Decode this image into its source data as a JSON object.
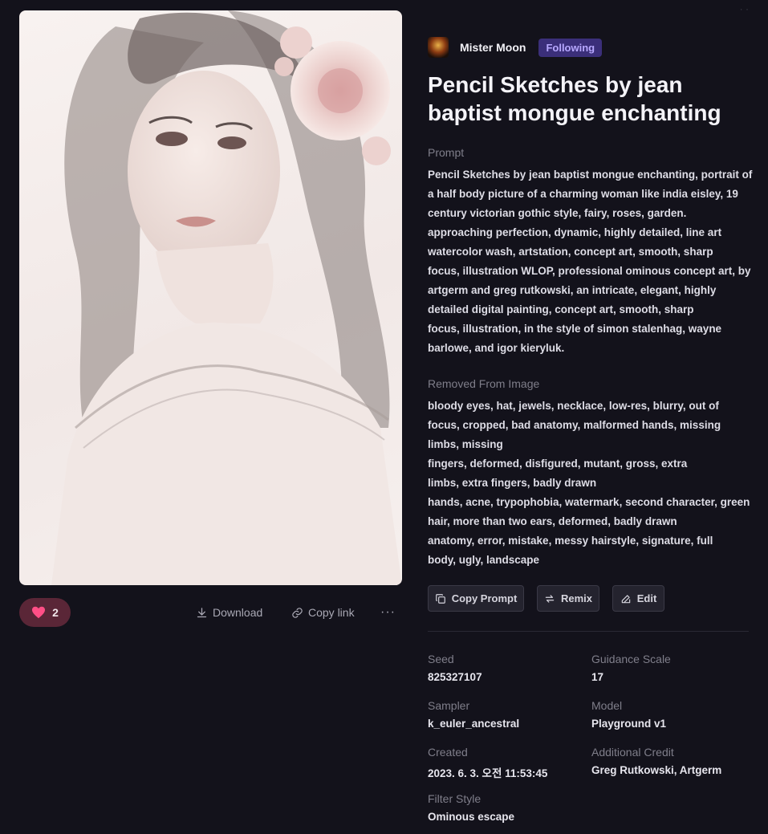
{
  "author": {
    "name": "Mister Moon",
    "follow_state": "Following"
  },
  "title": "Pencil Sketches by jean baptist mongue enchanting",
  "prompt": {
    "label": "Prompt",
    "lines": [
      "Pencil Sketches by jean baptist mongue enchanting, portrait of",
      "a half body picture of a charming woman like india eisley, 19",
      "century victorian gothic style, fairy, roses, garden.",
      "approaching perfection, dynamic, highly detailed, line art",
      "watercolor wash, artstation, concept art, smooth, sharp",
      "focus, illustration WLOP, professional ominous concept art, by",
      "artgerm and greg rutkowski, an intricate, elegant, highly",
      "detailed digital painting, concept art, smooth, sharp",
      "focus, illustration, in the style of simon stalenhag, wayne",
      "barlowe, and igor kieryluk."
    ]
  },
  "removed": {
    "label": "Removed From Image",
    "lines": [
      "bloody eyes, hat, jewels, necklace, low-res, blurry, out of",
      "focus, cropped, bad anatomy, malformed hands, missing",
      "limbs, missing",
      "fingers, deformed, disfigured, mutant, gross, extra",
      "limbs, extra fingers, badly drawn",
      "hands, acne, trypophobia, watermark, second character, green",
      "hair, more than two ears, deformed, badly drawn",
      "anatomy, error, mistake, messy hairstyle, signature, full",
      "body, ugly, landscape"
    ]
  },
  "buttons": {
    "copy_prompt": "Copy Prompt",
    "remix": "Remix",
    "edit": "Edit"
  },
  "actions": {
    "likes": "2",
    "download": "Download",
    "copy_link": "Copy link",
    "more": "···"
  },
  "meta": {
    "seed": {
      "label": "Seed",
      "value": "825327107"
    },
    "guidance": {
      "label": "Guidance Scale",
      "value": "17"
    },
    "sampler": {
      "label": "Sampler",
      "value": "k_euler_ancestral"
    },
    "model": {
      "label": "Model",
      "value": "Playground v1"
    },
    "created": {
      "label": "Created",
      "value": "2023. 6. 3. 오전 11:53:45"
    },
    "credit": {
      "label": "Additional Credit",
      "value": "Greg Rutkowski, Artgerm"
    },
    "filter": {
      "label": "Filter Style",
      "value": "Ominous escape"
    }
  },
  "colors": {
    "background": "#13121b",
    "like_pill": "#5a2637",
    "heart": "#ff4f86",
    "following_badge": "#3b2f7a"
  }
}
